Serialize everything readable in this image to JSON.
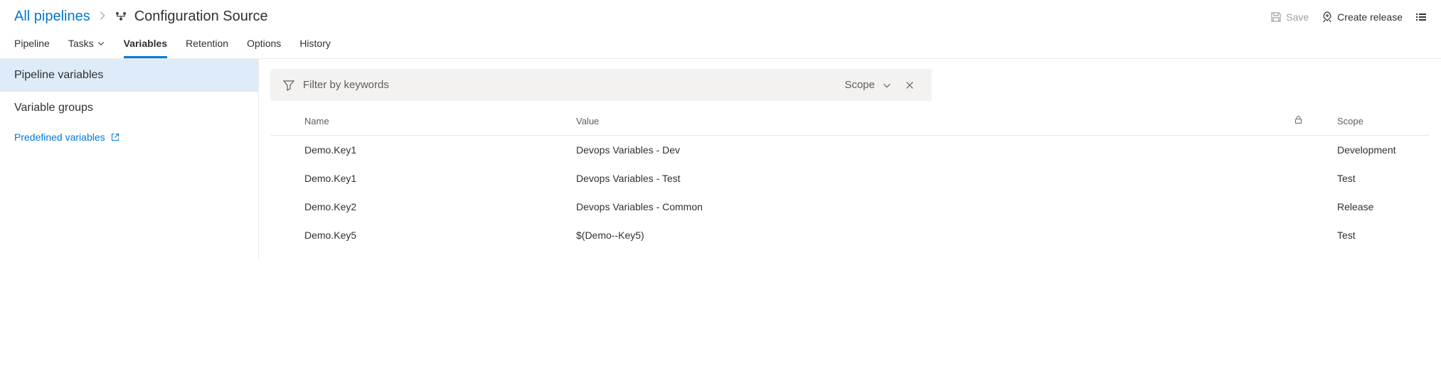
{
  "breadcrumb": {
    "root": "All pipelines",
    "title": "Configuration Source"
  },
  "headerActions": {
    "save": "Save",
    "createRelease": "Create release"
  },
  "tabs": {
    "pipeline": "Pipeline",
    "tasks": "Tasks",
    "variables": "Variables",
    "retention": "Retention",
    "options": "Options",
    "history": "History"
  },
  "sidebar": {
    "pipelineVariables": "Pipeline variables",
    "variableGroups": "Variable groups",
    "predefined": "Predefined variables"
  },
  "filter": {
    "placeholder": "Filter by keywords",
    "scope": "Scope"
  },
  "columns": {
    "name": "Name",
    "value": "Value",
    "scope": "Scope"
  },
  "rows": [
    {
      "name": "Demo.Key1",
      "value": "Devops Variables - Dev",
      "scope": "Development"
    },
    {
      "name": "Demo.Key1",
      "value": "Devops Variables - Test",
      "scope": "Test"
    },
    {
      "name": "Demo.Key2",
      "value": "Devops Variables - Common",
      "scope": "Release"
    },
    {
      "name": "Demo.Key5",
      "value": "$(Demo--Key5)",
      "scope": "Test"
    }
  ]
}
